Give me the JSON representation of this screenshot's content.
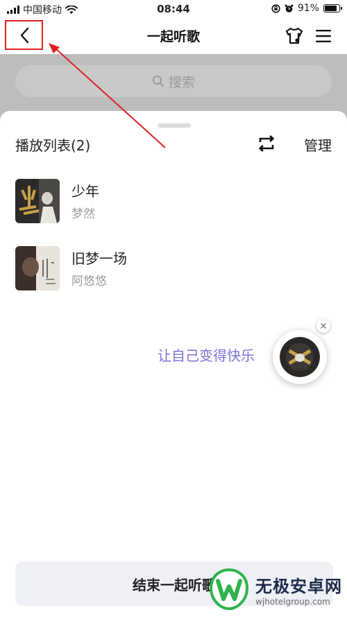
{
  "status_bar": {
    "carrier": "中国移动",
    "time": "08:44",
    "battery": "91%"
  },
  "nav": {
    "title": "一起听歌",
    "back_icon": "chevron-left-icon",
    "tshirt_icon": "tshirt-icon",
    "menu_icon": "hamburger-menu-icon"
  },
  "search": {
    "placeholder": "搜索"
  },
  "playlist": {
    "title": "播放列表(2)",
    "manage_label": "管理",
    "songs": [
      {
        "name": "少年",
        "artist": "梦然"
      },
      {
        "name": "旧梦一场",
        "artist": "阿悠悠"
      }
    ]
  },
  "promo": {
    "text": "让自己变得快乐"
  },
  "end_button": {
    "label": "结束一起听歌"
  },
  "watermark": {
    "title": "无极安卓网",
    "url": "wjhotelgroup.com"
  },
  "colors": {
    "accent": "#7b72d8",
    "highlight_box": "#e02020",
    "arrow": "#e02020",
    "watermark_logo": "#2fb24c"
  }
}
